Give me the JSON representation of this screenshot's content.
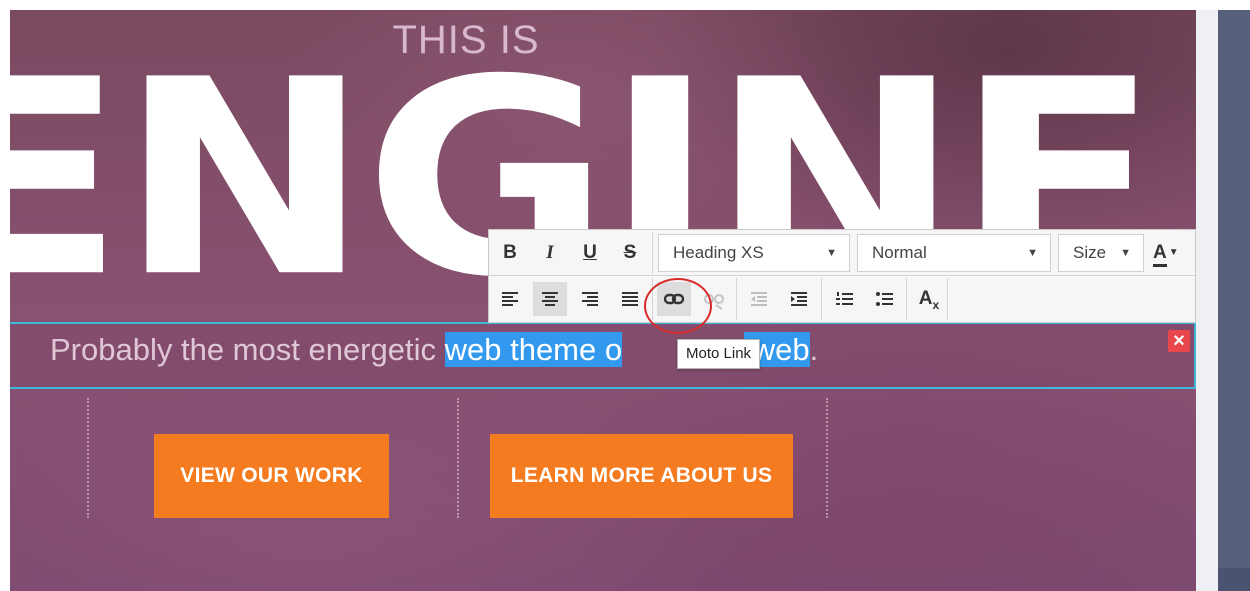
{
  "hero": {
    "kicker": "THIS IS",
    "headline": "ENGINE",
    "tagline_before": "Probably the most energetic ",
    "tagline_selected_1": "web theme o",
    "tagline_selected_2": " web",
    "tagline_after": "."
  },
  "toolbar": {
    "bold": "B",
    "italic": "I",
    "underline": "U",
    "strike": "S",
    "heading_select": "Heading XS",
    "style_select": "Normal",
    "size_select": "Size",
    "color_letter": "A",
    "clear_format": "A"
  },
  "tooltip": {
    "text": "Moto Link"
  },
  "buttons": {
    "view_work": "VIEW OUR WORK",
    "learn_more": "LEARN MORE ABOUT US"
  },
  "colors": {
    "selection": "#3399ee",
    "cta": "#f47b20",
    "edit_outline": "#3fb7d8",
    "highlight_ring": "#d92a2a"
  }
}
